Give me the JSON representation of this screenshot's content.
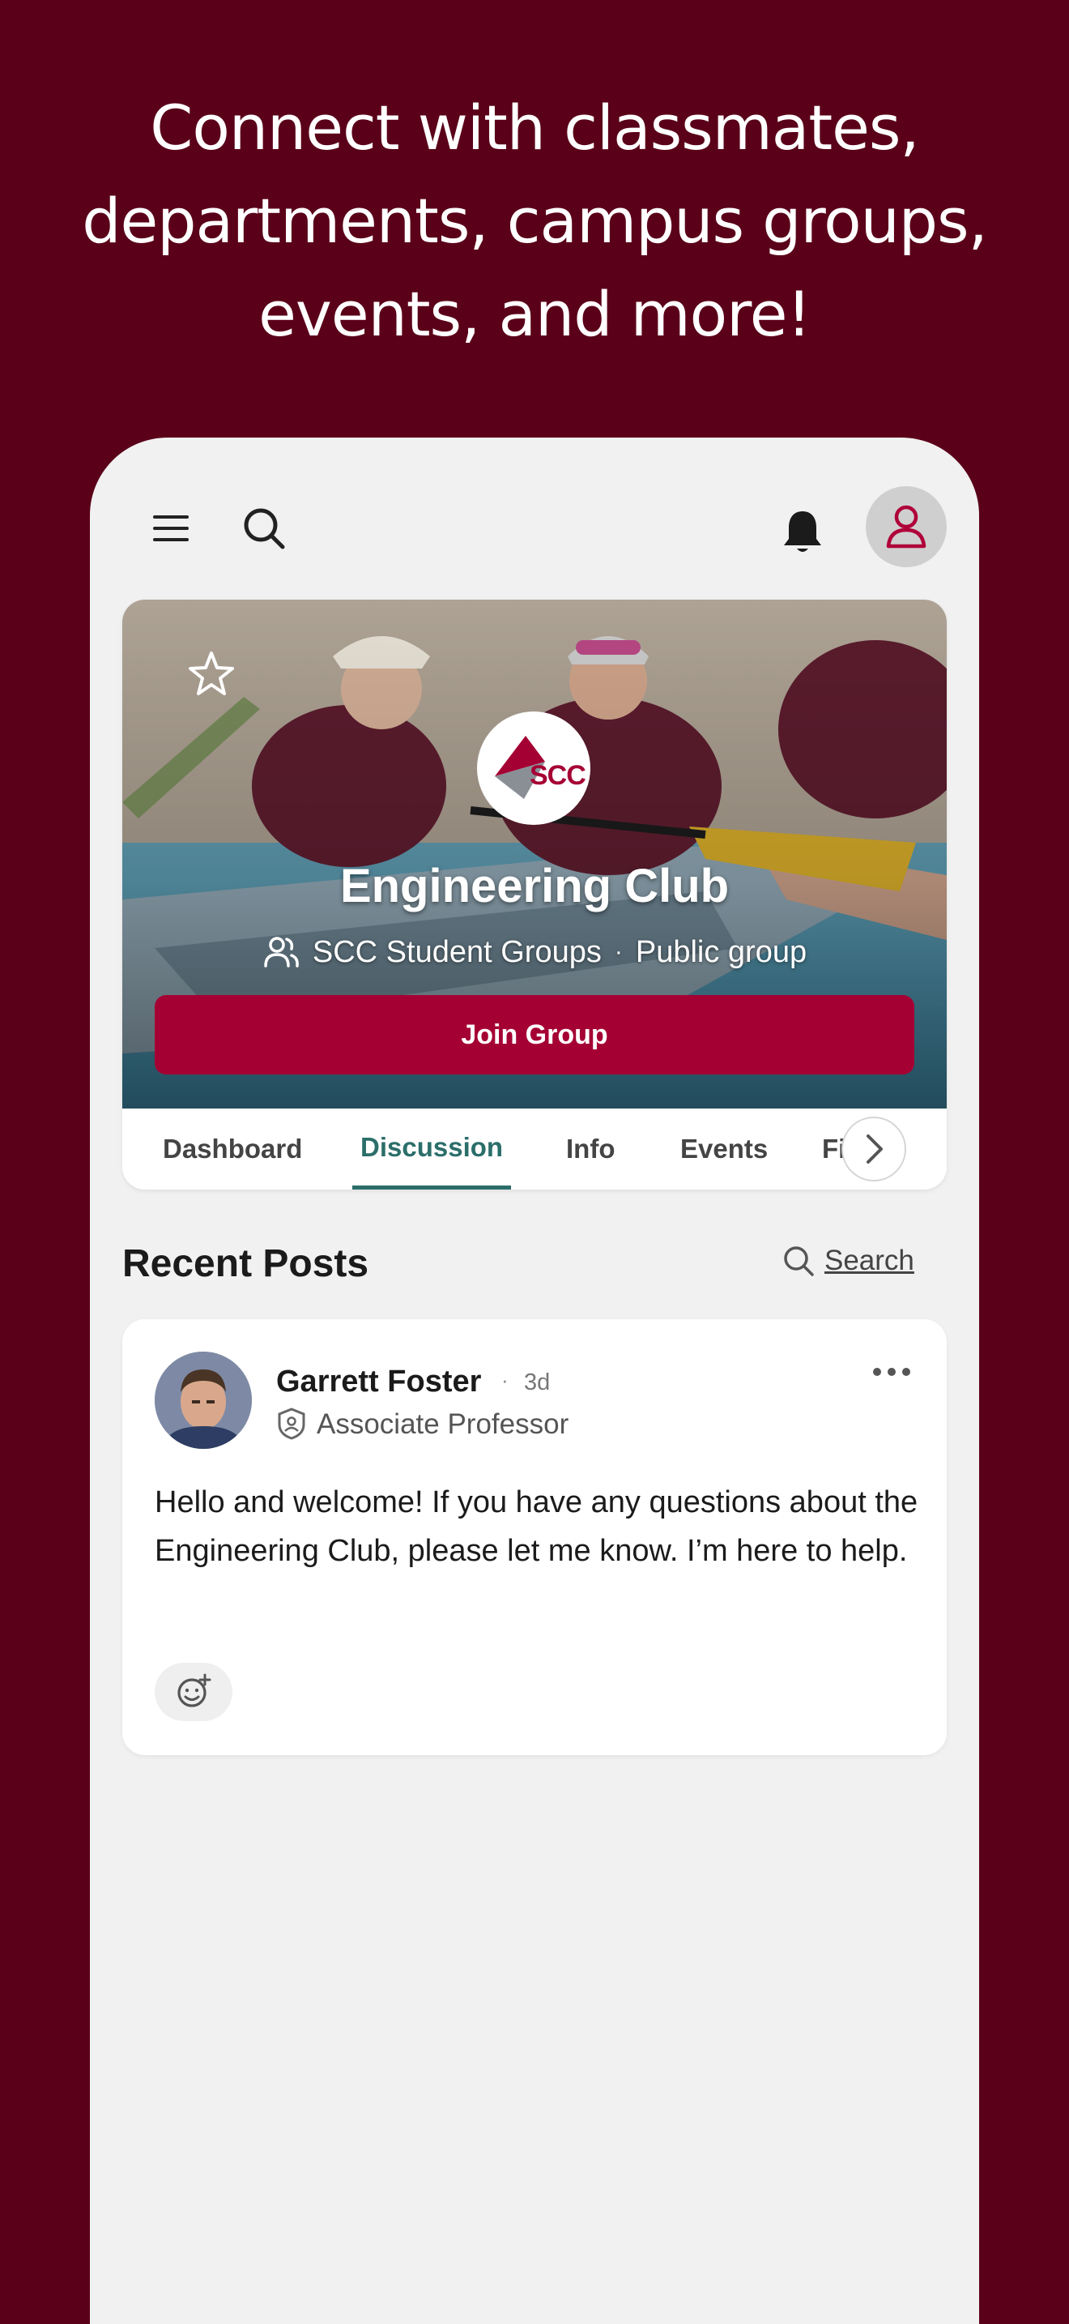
{
  "promo": {
    "line1": "Connect with classmates,",
    "line2": "departments, campus groups,",
    "line3": "events, and more!"
  },
  "colors": {
    "background": "#5a0019",
    "brand": "#a50034",
    "active_tab": "#2b6e6a"
  },
  "topbar": {
    "icons": [
      "menu-icon",
      "search-icon",
      "bell-icon",
      "user-icon"
    ]
  },
  "group": {
    "logo_text": "SCC",
    "name": "Engineering Club",
    "category": "SCC Student Groups",
    "separator": "·",
    "visibility": "Public group",
    "join_label": "Join Group",
    "favorite_icon": "star-icon"
  },
  "tabs": [
    {
      "label": "Dashboard",
      "active": false
    },
    {
      "label": "Discussion",
      "active": true
    },
    {
      "label": "Info",
      "active": false
    },
    {
      "label": "Events",
      "active": false
    },
    {
      "label": "Fi",
      "active": false
    }
  ],
  "posts_section": {
    "title": "Recent Posts",
    "search_label": "Search"
  },
  "post": {
    "author": "Garrett Foster",
    "dot": "·",
    "time": "3d",
    "role": "Associate Professor",
    "body": "Hello and welcome! If you have any questions about the Engineering Club, please let me know. I’m here to help."
  }
}
